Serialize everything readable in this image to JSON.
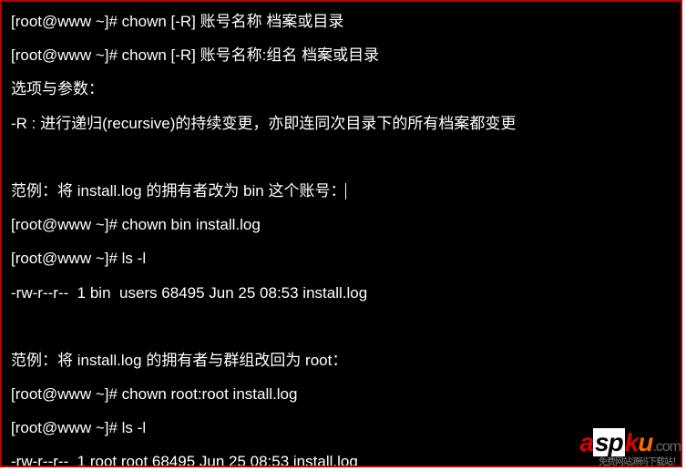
{
  "lines": {
    "l1": "[root@www ~]# chown [-R] 账号名称 档案或目录",
    "l2": "[root@www ~]# chown [-R] 账号名称:组名 档案或目录",
    "l3": "选项与参数：",
    "l4": "-R : 进行递归(recursive)的持续变更，亦即连同次目录下的所有档案都变更",
    "l5": "",
    "l6": "范例：将 install.log 的拥有者改为 bin 这个账号：",
    "l7": "[root@www ~]# chown bin install.log",
    "l8": "[root@www ~]# ls -l",
    "l9": "-rw-r--r--  1 bin  users 68495 Jun 25 08:53 install.log",
    "l10": "",
    "l11": "范例：将 install.log 的拥有者与群组改回为 root：",
    "l12": "[root@www ~]# chown root:root install.log",
    "l13": "[root@www ~]# ls -l",
    "l14": "-rw-r--r--  1 root root 68495 Jun 25 08:53 install.log"
  },
  "watermark": {
    "p1": "a",
    "p2": "sp",
    "p3": "k",
    "p4": "u",
    "p5": ".com",
    "sub": "免费网站源码下载站！"
  }
}
